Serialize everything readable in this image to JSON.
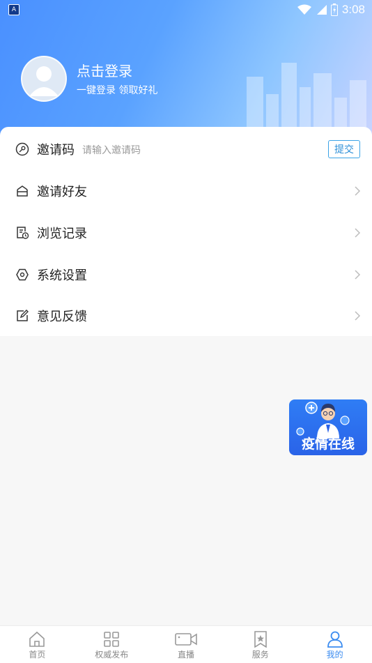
{
  "status_bar": {
    "app_icon_letter": "A",
    "time": "3:08"
  },
  "profile": {
    "login_title": "点击登录",
    "login_subtitle": "一键登录  领取好礼"
  },
  "invite": {
    "label": "邀请码",
    "placeholder": "请输入邀请码",
    "value": "",
    "submit_label": "提交"
  },
  "menu": {
    "items": [
      {
        "label": "邀请好友",
        "icon": "invite-friend-icon"
      },
      {
        "label": "浏览记录",
        "icon": "history-icon"
      },
      {
        "label": "系统设置",
        "icon": "settings-icon"
      },
      {
        "label": "意见反馈",
        "icon": "feedback-icon"
      }
    ]
  },
  "float_banner": {
    "title": "疫情在线"
  },
  "tabbar": {
    "active_color": "#3b8cf0",
    "items": [
      {
        "label": "首页",
        "icon": "home-icon",
        "active": false
      },
      {
        "label": "权威发布",
        "icon": "grid-icon",
        "active": false
      },
      {
        "label": "直播",
        "icon": "video-icon",
        "active": false
      },
      {
        "label": "服务",
        "icon": "star-bookmark-icon",
        "active": false
      },
      {
        "label": "我的",
        "icon": "user-icon",
        "active": true
      }
    ]
  }
}
